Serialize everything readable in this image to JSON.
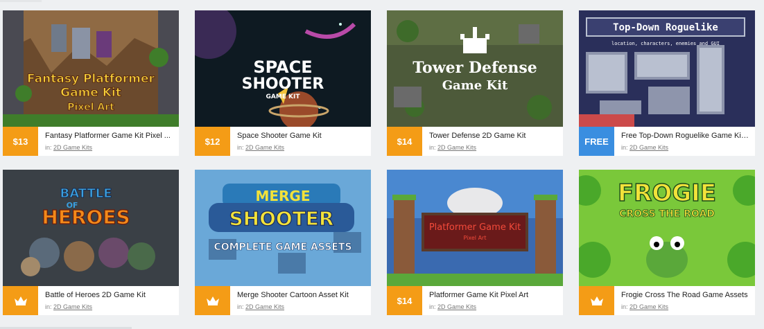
{
  "cards": [
    {
      "price": "$13",
      "title": "Fantasy Platformer Game Kit Pixel ...",
      "category_prefix": "in:",
      "category": "2D Game Kits",
      "thumb_text": [
        "Fantasy Platformer",
        "Game Kit",
        "Pixel Art"
      ]
    },
    {
      "price": "$12",
      "title": "Space Shooter Game Kit",
      "category_prefix": "in:",
      "category": "2D Game Kits",
      "thumb_text": [
        "SPACE",
        "SHOOTER",
        "GAME KIT"
      ]
    },
    {
      "price": "$14",
      "title": "Tower Defense 2D Game Kit",
      "category_prefix": "in:",
      "category": "2D Game Kits",
      "thumb_text": [
        "Tower Defense",
        "Game Kit"
      ]
    },
    {
      "price": "FREE",
      "title": "Free Top-Down Roguelike Game Kit ...",
      "category_prefix": "in:",
      "category": "2D Game Kits",
      "thumb_text": [
        "Top-Down Roguelike",
        "location, characters, enemies and GUI"
      ]
    },
    {
      "price": "",
      "price_icon": "crown-icon",
      "title": "Battle of Heroes 2D Game Kit",
      "category_prefix": "in:",
      "category": "2D Game Kits",
      "thumb_text": [
        "BATTLE",
        "OF",
        "HEROES"
      ]
    },
    {
      "price": "",
      "price_icon": "crown-icon",
      "title": "Merge Shooter Cartoon Asset Kit",
      "category_prefix": "in:",
      "category": "2D Game Kits",
      "thumb_text": [
        "MERGE",
        "SHOOTER",
        "COMPLETE GAME ASSETS"
      ]
    },
    {
      "price": "$14",
      "title": "Platformer Game Kit Pixel Art",
      "category_prefix": "in:",
      "category": "2D Game Kits",
      "thumb_text": [
        "Platformer Game Kit",
        "Pixel Art"
      ]
    },
    {
      "price": "",
      "price_icon": "crown-icon",
      "title": "Frogie Cross The Road Game Assets",
      "category_prefix": "in:",
      "category": "2D Game Kits",
      "thumb_text": [
        "FROGIE",
        "CROSS THE ROAD"
      ]
    }
  ],
  "colors": {
    "price_badge": "#f49c16",
    "free_badge": "#3a8ee0"
  }
}
